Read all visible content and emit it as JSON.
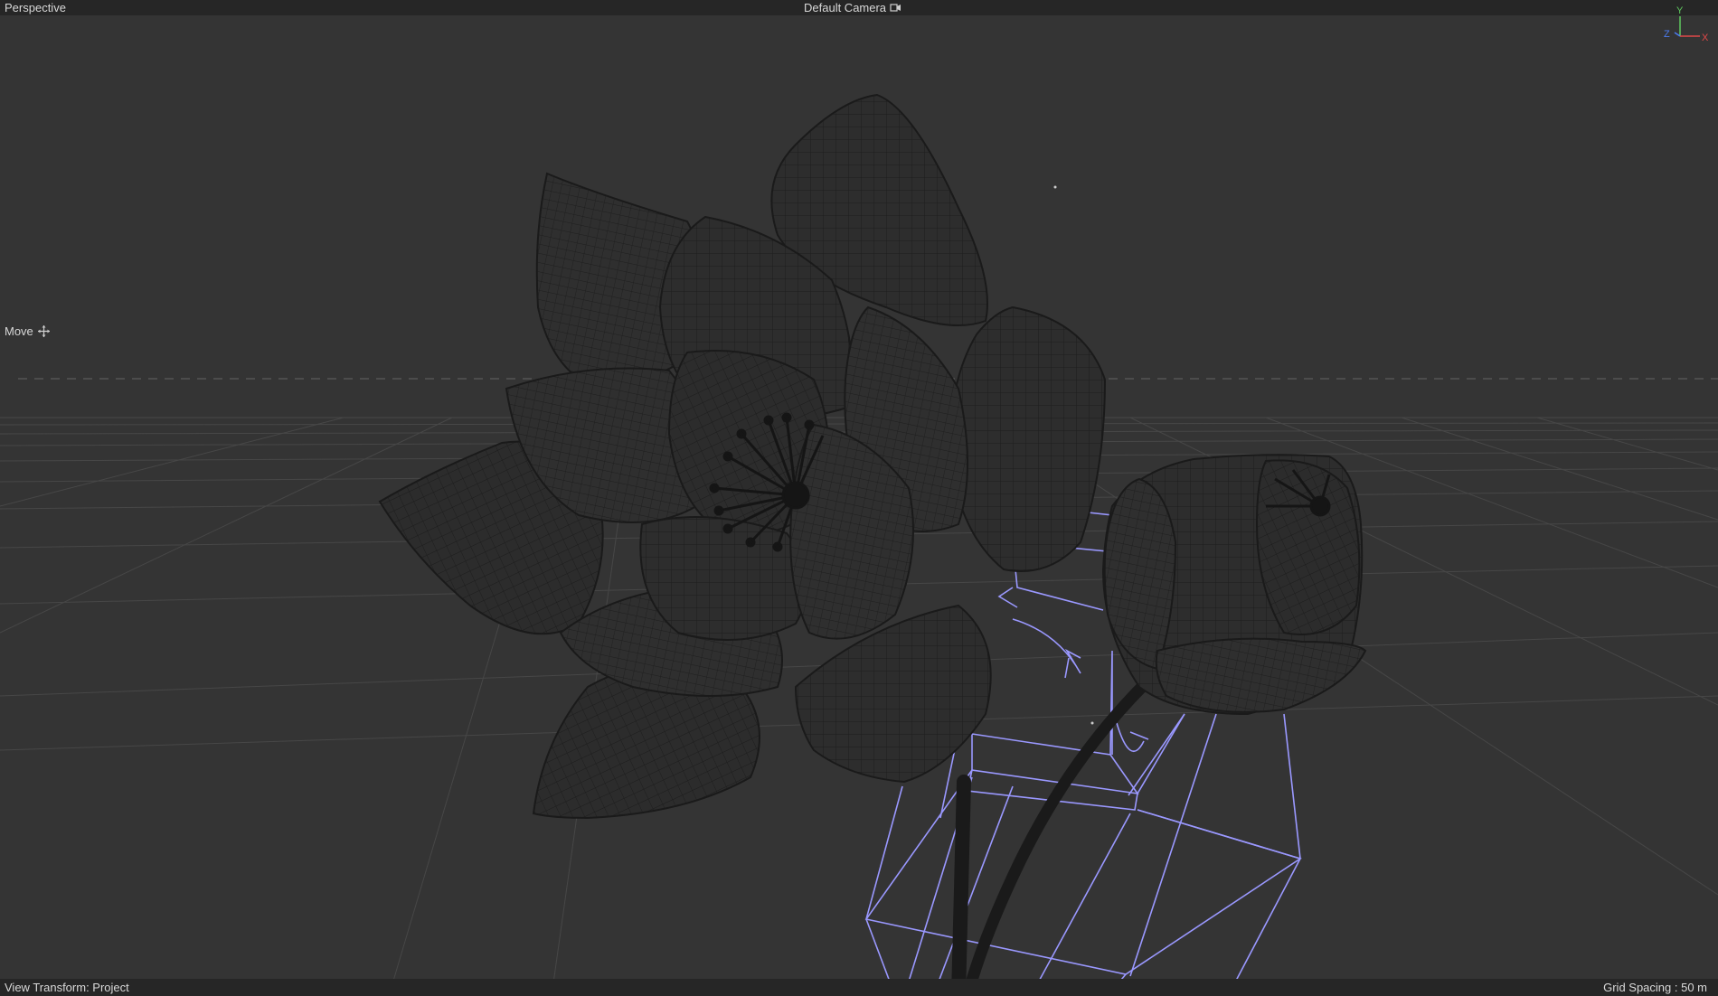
{
  "viewport": {
    "view_name": "Perspective",
    "camera_name": "Default Camera",
    "camera_icon": "camera-link-icon",
    "active_tool": "Move",
    "active_tool_icon": "move-cross-icon"
  },
  "axis_gizmo": {
    "y_label": "Y",
    "z_label": "Z",
    "x_label": "X",
    "colors": {
      "x": "#e04848",
      "y": "#5ec85e",
      "z": "#4c7cf0"
    }
  },
  "status": {
    "view_transform": "View Transform: Project",
    "grid_spacing": "Grid Spacing : 50 m"
  },
  "colors": {
    "background": "#343434",
    "bar": "#262626",
    "mesh_fill": "#2e2e2e",
    "mesh_wire": "#1c1c1c",
    "spline": "#9a98ff",
    "grid": "#4a4a4a"
  }
}
